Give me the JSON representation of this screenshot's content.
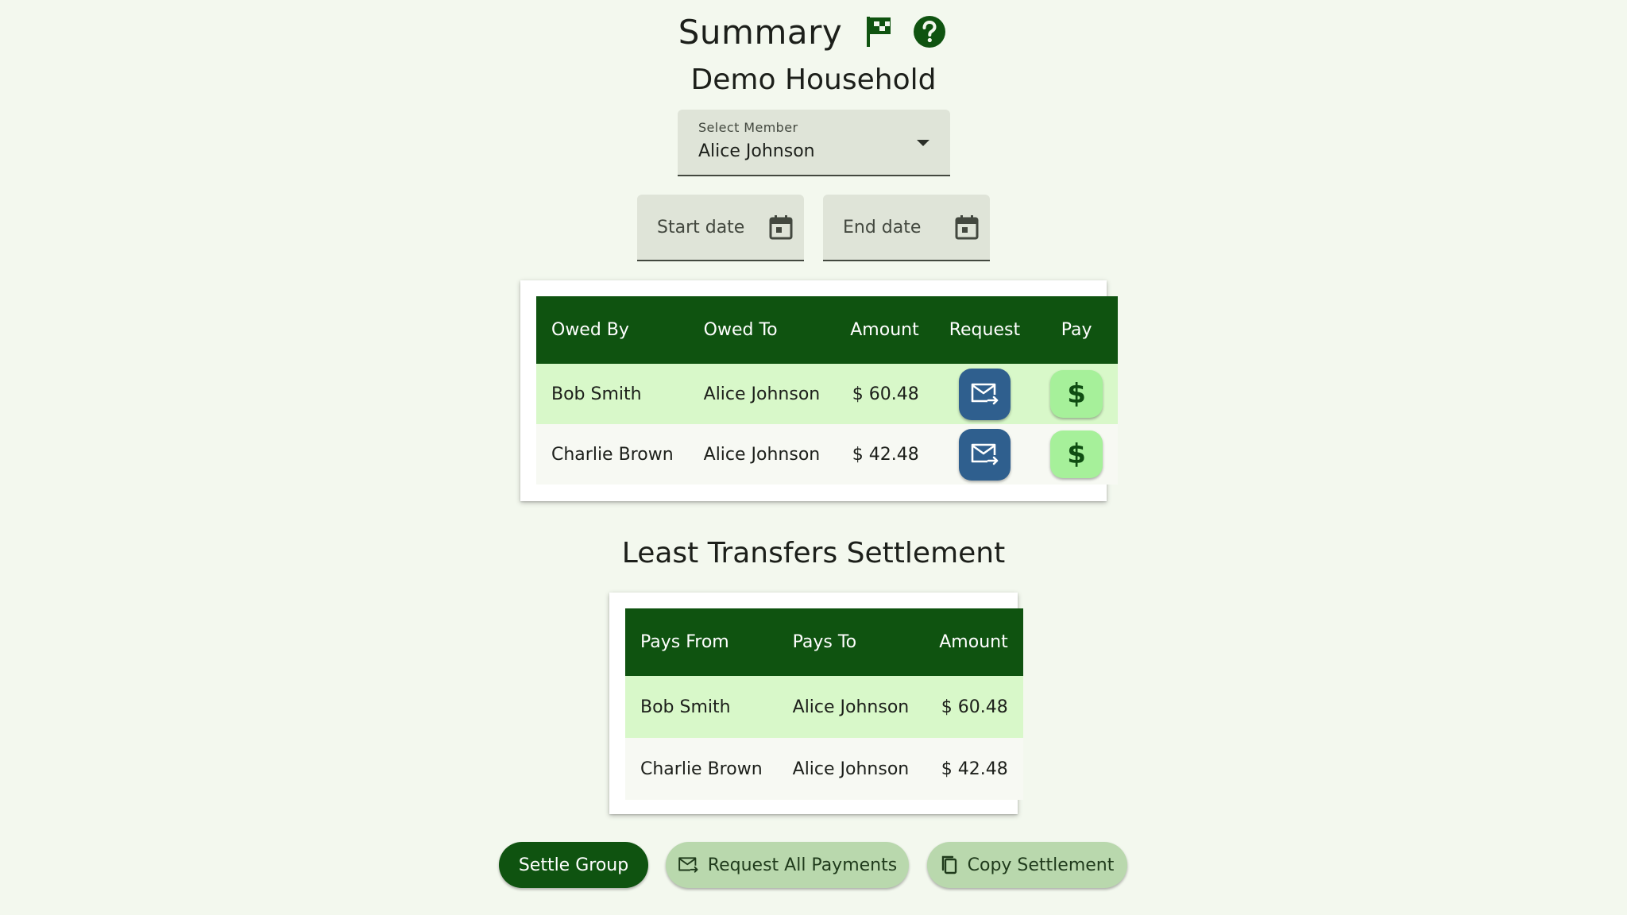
{
  "header": {
    "title": "Summary",
    "flag_icon": "flag-icon",
    "help_icon": "help-icon"
  },
  "household": {
    "name": "Demo Household"
  },
  "member_select": {
    "label": "Select Member",
    "value": "Alice Johnson"
  },
  "date_range": {
    "start_placeholder": "Start date",
    "end_placeholder": "End date"
  },
  "owed_table": {
    "headers": {
      "owed_by": "Owed By",
      "owed_to": "Owed To",
      "amount": "Amount",
      "request": "Request",
      "pay": "Pay"
    },
    "rows": [
      {
        "owed_by": "Bob Smith",
        "owed_to": "Alice Johnson",
        "amount": "$ 60.48"
      },
      {
        "owed_by": "Charlie Brown",
        "owed_to": "Alice Johnson",
        "amount": "$ 42.48"
      }
    ]
  },
  "settlement": {
    "title": "Least Transfers Settlement",
    "headers": {
      "pays_from": "Pays From",
      "pays_to": "Pays To",
      "amount": "Amount"
    },
    "rows": [
      {
        "pays_from": "Bob Smith",
        "pays_to": "Alice Johnson",
        "amount": "$ 60.48"
      },
      {
        "pays_from": "Charlie Brown",
        "pays_to": "Alice Johnson",
        "amount": "$ 42.48"
      }
    ]
  },
  "actions": {
    "settle_group": "Settle Group",
    "request_all": "Request All Payments",
    "copy_settlement": "Copy Settlement"
  },
  "colors": {
    "primary": "#0f5310",
    "background": "#f3f8ee",
    "row_highlight": "#d8f8c9",
    "request_button": "#2f5f8e",
    "pay_button": "#a6f09a",
    "secondary_pill": "#b9d8ad"
  }
}
